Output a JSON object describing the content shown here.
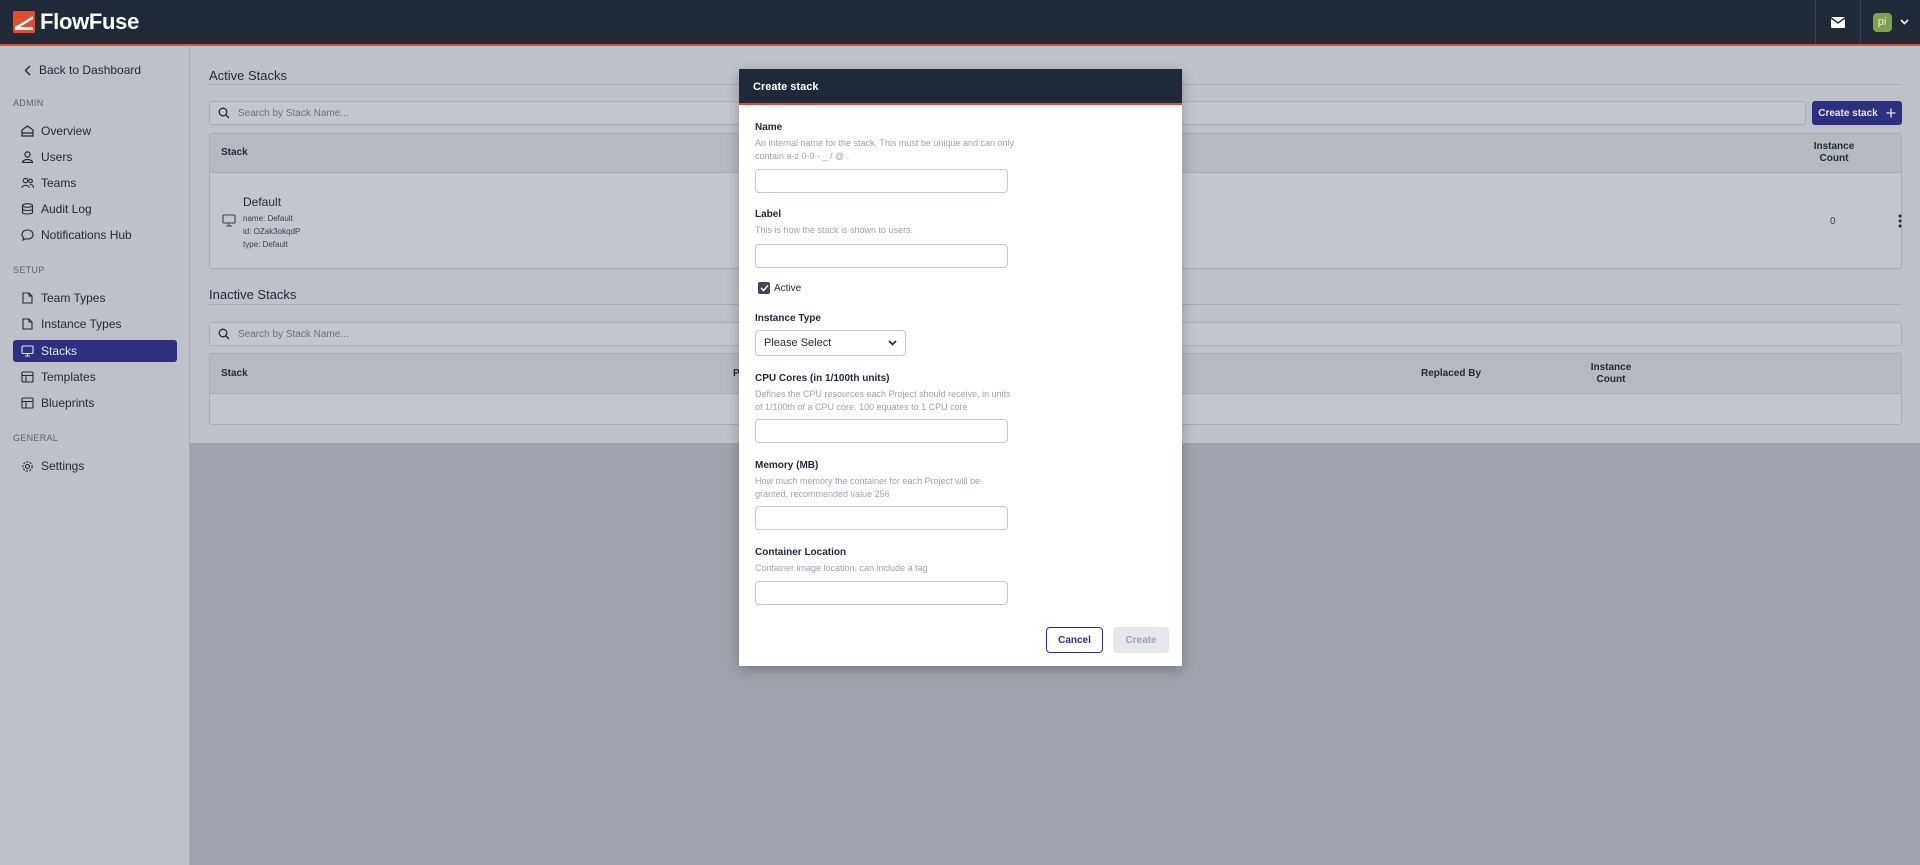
{
  "app": {
    "name": "FlowFuse"
  },
  "colors": {
    "brand": "#e24d2e",
    "header": "#1f2937",
    "accent": "#2f2f80"
  },
  "header": {
    "user_initials": "pi",
    "icons": [
      "mail-icon",
      "chevron-down-icon"
    ]
  },
  "sidebar": {
    "back_label": "Back to Dashboard",
    "sections": [
      {
        "label": "ADMIN",
        "items": [
          {
            "label": "Overview",
            "icon": "building-icon"
          },
          {
            "label": "Users",
            "icon": "user-icon"
          },
          {
            "label": "Teams",
            "icon": "users-icon"
          },
          {
            "label": "Audit Log",
            "icon": "database-icon"
          },
          {
            "label": "Notifications Hub",
            "icon": "chat-icon"
          }
        ]
      },
      {
        "label": "SETUP",
        "items": [
          {
            "label": "Team Types",
            "icon": "document-icon"
          },
          {
            "label": "Instance Types",
            "icon": "document-icon"
          },
          {
            "label": "Stacks",
            "icon": "desktop-icon",
            "active": true
          },
          {
            "label": "Templates",
            "icon": "template-icon"
          },
          {
            "label": "Blueprints",
            "icon": "template-icon"
          }
        ]
      },
      {
        "label": "GENERAL",
        "items": [
          {
            "label": "Settings",
            "icon": "gear-icon"
          }
        ]
      }
    ]
  },
  "active_stacks": {
    "title": "Active Stacks",
    "search_placeholder": "Search by Stack Name...",
    "create_label": "Create stack",
    "columns": {
      "stack": "Stack",
      "instance_count": "Instance Count"
    },
    "rows": [
      {
        "name": "Default",
        "meta_name": "name: Default",
        "meta_id": "id: OZak3okqdP",
        "meta_type": "type: Default",
        "instance_count": "0"
      }
    ]
  },
  "inactive_stacks": {
    "title": "Inactive Stacks",
    "search_placeholder": "Search by Stack Name...",
    "columns": {
      "stack": "Stack",
      "col2": "P",
      "replaced_by": "Replaced By",
      "instance_count": "Instance Count"
    }
  },
  "modal": {
    "title": "Create stack",
    "name_label": "Name",
    "name_help": "An internal name for the stack. This must be unique and can only contain a-z 0-9 - _ / @ .",
    "name_value": "",
    "label_label": "Label",
    "label_help": "This is how the stack is shown to users.",
    "label_value": "",
    "active_label": "Active",
    "active_checked": true,
    "instance_type_label": "Instance Type",
    "instance_type_value": "Please Select",
    "cpu_label": "CPU Cores (in 1/100th units)",
    "cpu_help": "Defines the CPU resources each Project should receive, in units of 1/100th of a CPU core. 100 equates to 1 CPU core",
    "cpu_value": "",
    "memory_label": "Memory (MB)",
    "memory_help": "How much memory the container for each Project will be granted, recommended value 256",
    "memory_value": "",
    "container_label": "Container Location",
    "container_help": "Container image location, can include a tag",
    "container_value": "",
    "cancel_label": "Cancel",
    "create_label": "Create"
  }
}
